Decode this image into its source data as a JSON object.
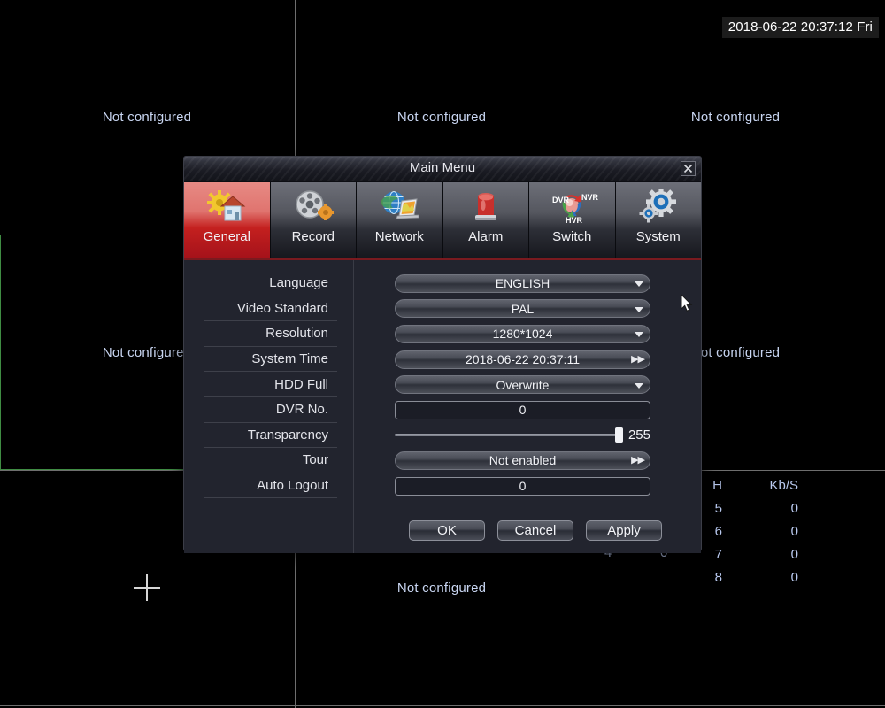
{
  "osd": {
    "clock": "2018-06-22 20:37:12 Fri"
  },
  "video_wall": {
    "not_configured_label": "Not configured",
    "cells": [
      {
        "label": "Not configured"
      },
      {
        "label": "Not configured"
      },
      {
        "label": "Not configured"
      },
      {
        "label": "Not configured"
      },
      {
        "label": "Not configured"
      },
      {
        "label": "Not configured"
      }
    ]
  },
  "stats": {
    "header_channel": "H",
    "header_rate": "Kb/S",
    "rows": [
      {
        "channel": "5",
        "rate": "0"
      },
      {
        "channel": "6",
        "rate": "0"
      },
      {
        "channel": "7",
        "rate": "0"
      },
      {
        "channel": "8",
        "rate": "0"
      }
    ],
    "partial_left": {
      "channel": "4",
      "rate": "0"
    }
  },
  "dialog": {
    "title": "Main Menu",
    "close_icon": "close-icon",
    "tabs": [
      {
        "label": "General",
        "icon": "house-gear-icon",
        "active": true
      },
      {
        "label": "Record",
        "icon": "film-reel-gear-icon",
        "active": false
      },
      {
        "label": "Network",
        "icon": "globe-laptop-icon",
        "active": false
      },
      {
        "label": "Alarm",
        "icon": "siren-icon",
        "active": false
      },
      {
        "label": "Switch",
        "icon": "dvr-nvr-hvr-cycle-icon",
        "active": false
      },
      {
        "label": "System",
        "icon": "gears-icon",
        "active": false
      }
    ],
    "fields": [
      {
        "label": "Language",
        "type": "combo",
        "value": "ENGLISH"
      },
      {
        "label": "Video Standard",
        "type": "combo",
        "value": "PAL"
      },
      {
        "label": "Resolution",
        "type": "combo",
        "value": "1280*1024"
      },
      {
        "label": "System Time",
        "type": "combo2",
        "value": "2018-06-22 20:37:11"
      },
      {
        "label": "HDD Full",
        "type": "combo",
        "value": "Overwrite"
      },
      {
        "label": "DVR No.",
        "type": "text",
        "value": "0"
      },
      {
        "label": "Transparency",
        "type": "slider",
        "value": "255",
        "percent": 100
      },
      {
        "label": "Tour",
        "type": "combo2",
        "value": "Not enabled"
      },
      {
        "label": "Auto Logout",
        "type": "text",
        "value": "0"
      }
    ],
    "buttons": [
      {
        "label": "OK",
        "name": "ok-button"
      },
      {
        "label": "Cancel",
        "name": "cancel-button"
      },
      {
        "label": "Apply",
        "name": "apply-button"
      }
    ]
  },
  "colors": {
    "accent_red": "#c4201f",
    "dialog_bg": "#22242e",
    "grid_line": "#6e6e6e",
    "selection_green": "#3f8c43",
    "osd_text": "#c9d6f2"
  }
}
